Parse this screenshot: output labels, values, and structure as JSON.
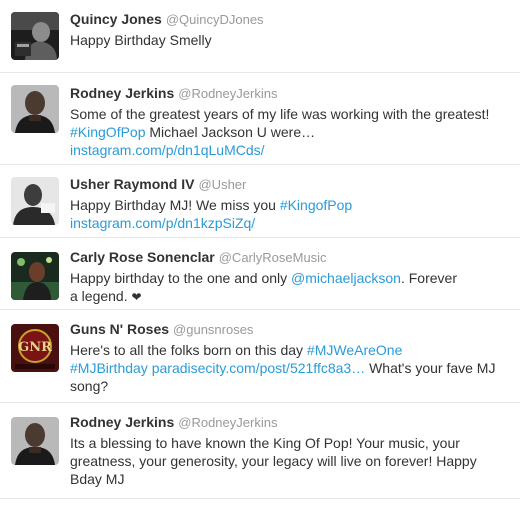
{
  "tweets": [
    {
      "name": "Quincy Jones",
      "handle": "@QuincyDJones",
      "avatar_icon": "quincy-jones-avatar",
      "text_parts": [
        {
          "type": "text",
          "value": "Happy Birthday Smelly"
        }
      ]
    },
    {
      "name": "Rodney Jerkins",
      "handle": "@RodneyJerkins",
      "avatar_icon": "rodney-jerkins-avatar",
      "text_parts": [
        {
          "type": "text",
          "value": "Some of the greatest years of my life was working with the greatest! "
        },
        {
          "type": "hashtag",
          "value": "#KingOfPop"
        },
        {
          "type": "text",
          "value": " Michael Jackson U were…"
        },
        {
          "type": "break"
        },
        {
          "type": "link",
          "value": "instagram.com/p/dn1qLuMCds/"
        }
      ]
    },
    {
      "name": "Usher Raymond IV",
      "handle": "@Usher",
      "avatar_icon": "usher-avatar",
      "text_parts": [
        {
          "type": "text",
          "value": "Happy Birthday MJ! We miss you "
        },
        {
          "type": "hashtag",
          "value": "#KingofPop"
        },
        {
          "type": "break"
        },
        {
          "type": "link",
          "value": "instagram.com/p/dn1kzpSiZq/"
        }
      ]
    },
    {
      "name": "Carly Rose Sonenclar",
      "handle": "@CarlyRoseMusic",
      "avatar_icon": "carly-rose-avatar",
      "text_parts": [
        {
          "type": "text",
          "value": "Happy birthday to the one and only "
        },
        {
          "type": "mention",
          "value": "@michaeljackson"
        },
        {
          "type": "text",
          "value": ". Forever"
        },
        {
          "type": "break"
        },
        {
          "type": "text",
          "value": "a legend. "
        },
        {
          "type": "heart",
          "value": "❤"
        }
      ]
    },
    {
      "name": "Guns N' Roses",
      "handle": "@gunsnroses",
      "avatar_icon": "guns-n-roses-avatar",
      "avatar_text": "GNR",
      "text_parts": [
        {
          "type": "text",
          "value": "Here's to all the folks born on this day "
        },
        {
          "type": "hashtag",
          "value": "#MJWeAreOne"
        },
        {
          "type": "break"
        },
        {
          "type": "hashtag",
          "value": "#MJBirthday"
        },
        {
          "type": "text",
          "value": " "
        },
        {
          "type": "link",
          "value": "paradisecity.com/post/521ffc8a3…"
        },
        {
          "type": "text",
          "value": " What's your fave MJ"
        },
        {
          "type": "break"
        },
        {
          "type": "text",
          "value": "song?"
        }
      ]
    },
    {
      "name": "Rodney Jerkins",
      "handle": "@RodneyJerkins",
      "avatar_icon": "rodney-jerkins-avatar",
      "text_parts": [
        {
          "type": "text",
          "value": "Its a blessing to have known the King Of Pop! Your music, your"
        },
        {
          "type": "break"
        },
        {
          "type": "text",
          "value": "greatness, your generosity, your legacy will live on forever! Happy"
        },
        {
          "type": "break"
        },
        {
          "type": "text",
          "value": "Bday MJ"
        }
      ]
    }
  ],
  "colors": {
    "link": "#2a9bd6",
    "name": "#333333",
    "handle": "#999999",
    "divider": "#e8e8e8"
  }
}
